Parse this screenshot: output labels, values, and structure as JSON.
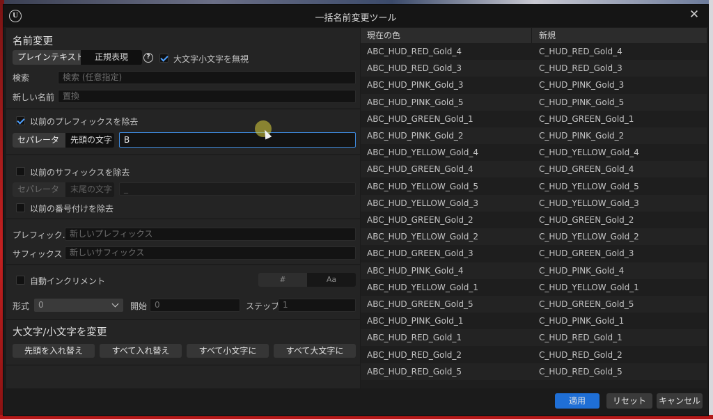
{
  "window": {
    "title": "一括名前変更ツール",
    "close": "✕"
  },
  "rename": {
    "heading": "名前変更",
    "mode_plain": "プレインテキスト",
    "mode_regex": "正規表現",
    "help": "?",
    "ignore_case_label": "大文字小文字を無視",
    "search_label": "検索",
    "search_placeholder": "検索 (任意指定)",
    "newname_label": "新しい名前",
    "newname_placeholder": "置換"
  },
  "prefix_remove": {
    "label": "以前のプレフィックスを除去",
    "seg_separator": "セパレータ",
    "seg_leading": "先頭の文字",
    "value": "B"
  },
  "suffix_remove": {
    "label": "以前のサフィックスを除去",
    "seg_separator": "セパレータ",
    "seg_trailing": "末尾の文字",
    "value": "_",
    "numbering_label": "以前の番号付けを除去"
  },
  "add": {
    "prefix_label": "プレフィック.",
    "prefix_placeholder": "新しいプレフィックス",
    "suffix_label": "サフィックス",
    "suffix_placeholder": "新しいサフィックス"
  },
  "increment": {
    "label": "自動インクリメント",
    "toggle_hash": "#",
    "toggle_aa": "Aa",
    "format_label": "形式",
    "format_value": "0",
    "start_label": "開始",
    "start_value": "0",
    "step_label": "ステップ",
    "step_value": "1"
  },
  "case": {
    "heading": "大文字/小文字を変更",
    "btn_swap_first": "先頭を入れ替え",
    "btn_swap_all": "すべて入れ替え",
    "btn_lower": "すべて小文字に",
    "btn_upper": "すべて大文字に"
  },
  "table": {
    "col_current": "現在の色",
    "col_new": "新規",
    "rows": [
      {
        "current": "ABC_HUD_RED_Gold_4",
        "new": "C_HUD_RED_Gold_4"
      },
      {
        "current": "ABC_HUD_RED_Gold_3",
        "new": "C_HUD_RED_Gold_3"
      },
      {
        "current": "ABC_HUD_PINK_Gold_3",
        "new": "C_HUD_PINK_Gold_3"
      },
      {
        "current": "ABC_HUD_PINK_Gold_5",
        "new": "C_HUD_PINK_Gold_5"
      },
      {
        "current": "ABC_HUD_GREEN_Gold_1",
        "new": "C_HUD_GREEN_Gold_1"
      },
      {
        "current": "ABC_HUD_PINK_Gold_2",
        "new": "C_HUD_PINK_Gold_2"
      },
      {
        "current": "ABC_HUD_YELLOW_Gold_4",
        "new": "C_HUD_YELLOW_Gold_4"
      },
      {
        "current": "ABC_HUD_GREEN_Gold_4",
        "new": "C_HUD_GREEN_Gold_4"
      },
      {
        "current": "ABC_HUD_YELLOW_Gold_5",
        "new": "C_HUD_YELLOW_Gold_5"
      },
      {
        "current": "ABC_HUD_YELLOW_Gold_3",
        "new": "C_HUD_YELLOW_Gold_3"
      },
      {
        "current": "ABC_HUD_GREEN_Gold_2",
        "new": "C_HUD_GREEN_Gold_2"
      },
      {
        "current": "ABC_HUD_YELLOW_Gold_2",
        "new": "C_HUD_YELLOW_Gold_2"
      },
      {
        "current": "ABC_HUD_GREEN_Gold_3",
        "new": "C_HUD_GREEN_Gold_3"
      },
      {
        "current": "ABC_HUD_PINK_Gold_4",
        "new": "C_HUD_PINK_Gold_4"
      },
      {
        "current": "ABC_HUD_YELLOW_Gold_1",
        "new": "C_HUD_YELLOW_Gold_1"
      },
      {
        "current": "ABC_HUD_GREEN_Gold_5",
        "new": "C_HUD_GREEN_Gold_5"
      },
      {
        "current": "ABC_HUD_PINK_Gold_1",
        "new": "C_HUD_PINK_Gold_1"
      },
      {
        "current": "ABC_HUD_RED_Gold_1",
        "new": "C_HUD_RED_Gold_1"
      },
      {
        "current": "ABC_HUD_RED_Gold_2",
        "new": "C_HUD_RED_Gold_2"
      },
      {
        "current": "ABC_HUD_RED_Gold_5",
        "new": "C_HUD_RED_Gold_5"
      }
    ]
  },
  "footer": {
    "apply": "適用",
    "reset": "リセット",
    "cancel": "キャンセル"
  },
  "colors": {
    "accent": "#1f6fd6",
    "check": "#4ea0ff",
    "focus_border": "#3e8be0"
  },
  "icons": {
    "logo": "unreal-logo-icon",
    "close": "close-icon",
    "help": "help-icon",
    "check": "check-icon",
    "chevron": "chevron-down-icon"
  }
}
